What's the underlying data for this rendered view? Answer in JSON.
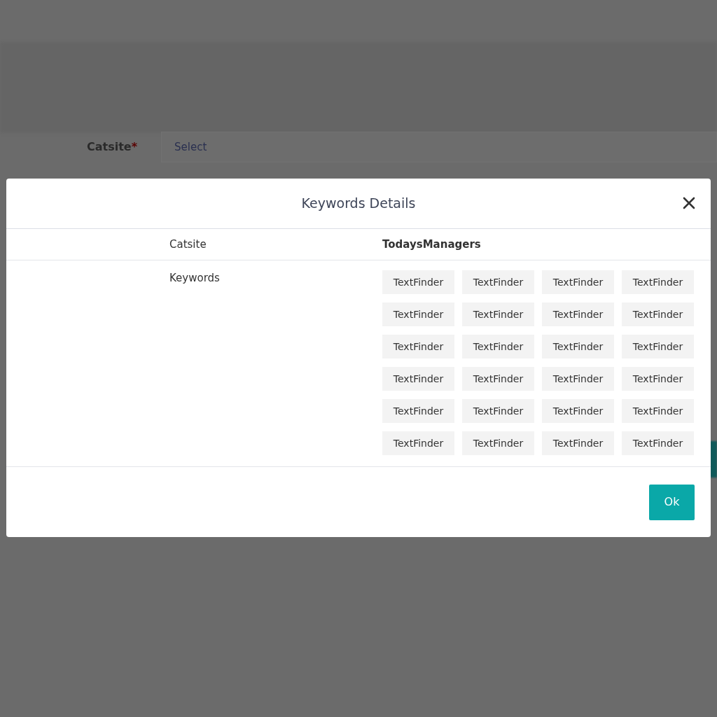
{
  "background_form": {
    "label": "Catsite",
    "required_mark": "*",
    "placeholder": "Select"
  },
  "dialog": {
    "title": "Keywords Details",
    "rows": [
      {
        "kind": "text",
        "label": "Catsite",
        "value": "TodaysManagers"
      },
      {
        "kind": "chips",
        "label": "Keywords",
        "chips": [
          "TextFinder",
          "TextFinder",
          "TextFinder",
          "TextFinder",
          "TextFinder",
          "TextFinder",
          "TextFinder",
          "TextFinder",
          "TextFinder",
          "TextFinder",
          "TextFinder",
          "TextFinder",
          "TextFinder",
          "TextFinder",
          "TextFinder",
          "TextFinder",
          "TextFinder",
          "TextFinder",
          "TextFinder",
          "TextFinder",
          "TextFinder",
          "TextFinder",
          "TextFinder",
          "TextFinder"
        ]
      }
    ],
    "buttons": [
      "Ok"
    ]
  }
}
